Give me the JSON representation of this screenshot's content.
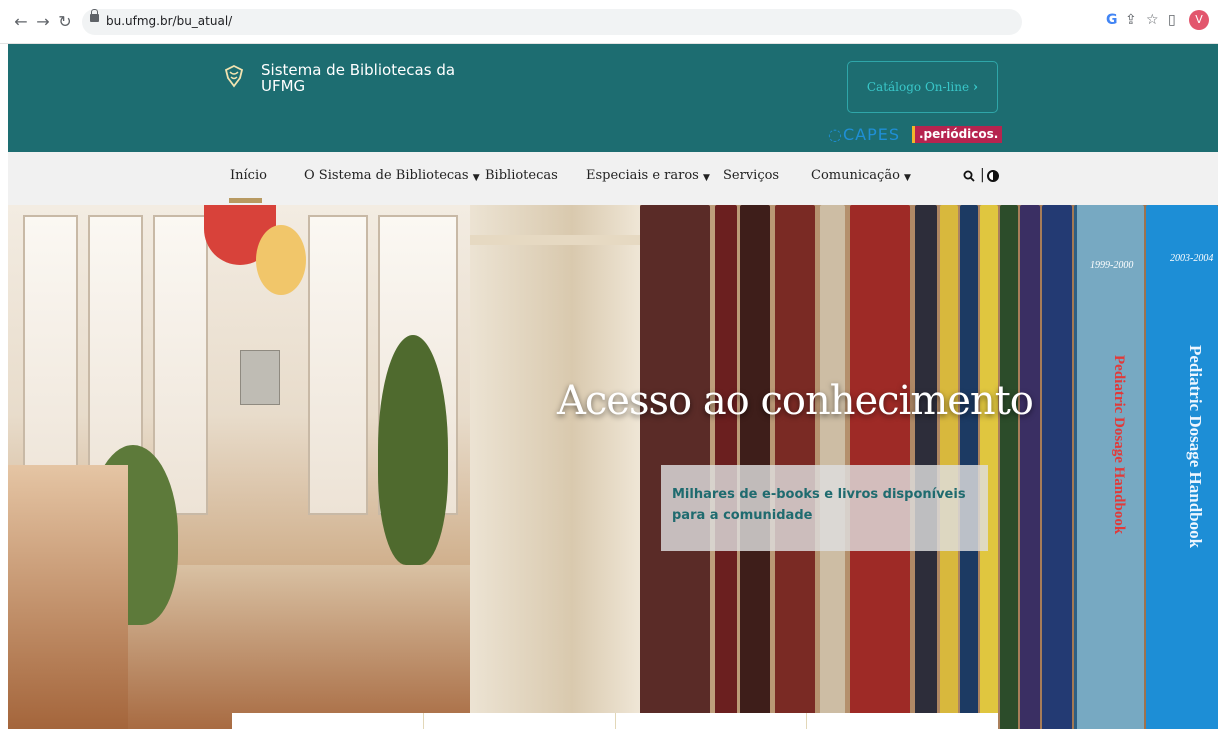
{
  "browser": {
    "url": "bu.ufmg.br/bu_atual/",
    "avatar_initial": "V",
    "icons": [
      "back-arrow-icon",
      "forward-arrow-icon",
      "reload-icon",
      "lock-icon",
      "google-icon",
      "share-icon",
      "bookmark-star-icon",
      "tab-icon"
    ]
  },
  "header": {
    "site_title": "Sistema de Bibliotecas da UFMG",
    "catalog_button": "Catálogo On-line",
    "capes_logo": "CAPES",
    "periodicos_logo": ".periódicos."
  },
  "nav": {
    "items": [
      {
        "label": "Início",
        "dropdown": false,
        "active": true
      },
      {
        "label": "O Sistema de Bibliotecas",
        "dropdown": true
      },
      {
        "label": "Bibliotecas",
        "dropdown": false
      },
      {
        "label": "Especiais e raros",
        "dropdown": true
      },
      {
        "label": "Serviços",
        "dropdown": false
      },
      {
        "label": "Comunicação",
        "dropdown": true
      }
    ],
    "divider": "|"
  },
  "hero": {
    "title": "Acesso ao conhecimento",
    "subtitle": "Milhares de e-books e livros disponíveis para a comunidade"
  },
  "colors": {
    "header_bg": "#1d6d71",
    "nav_bg": "#f1f1f1",
    "accent_teal": "#39c7c9",
    "active_underline": "#b89a62",
    "subtitle_text": "#1f6b6f"
  }
}
